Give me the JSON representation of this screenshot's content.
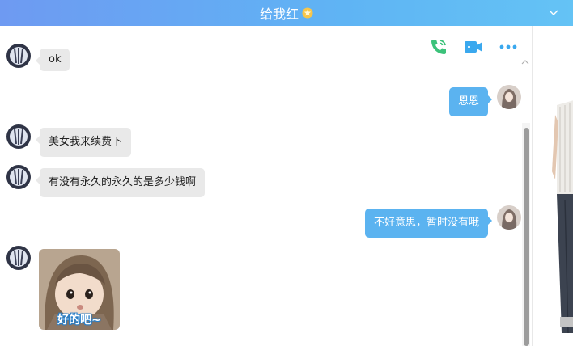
{
  "window": {
    "title": "给我红",
    "title_icon": "star-badge-icon",
    "header_colors": [
      "#6e9af2",
      "#64c3f5"
    ]
  },
  "toolbar": {
    "icons": [
      "phone-call-icon",
      "video-call-icon",
      "more-icon"
    ],
    "colors": {
      "phone": "#3cc27a",
      "video": "#3aa8ee",
      "more": "#3aa8ee"
    }
  },
  "messages": [
    {
      "direction": "incoming",
      "avatar": "contact-avatar",
      "text": "ok"
    },
    {
      "direction": "outgoing",
      "avatar": "self-avatar",
      "text": "恩恩"
    },
    {
      "direction": "incoming",
      "avatar": "contact-avatar",
      "text": "美女我来续费下"
    },
    {
      "direction": "incoming",
      "avatar": "contact-avatar",
      "text": "有没有永久的永久的是多少钱啊"
    },
    {
      "direction": "outgoing",
      "avatar": "self-avatar",
      "text": "不好意思，暂时没有哦"
    },
    {
      "direction": "incoming",
      "avatar": "contact-avatar",
      "type": "sticker",
      "caption": "好的吧~"
    }
  ],
  "colors": {
    "bubble_in": "#e9e9e9",
    "bubble_out": "#5bb3f0"
  }
}
